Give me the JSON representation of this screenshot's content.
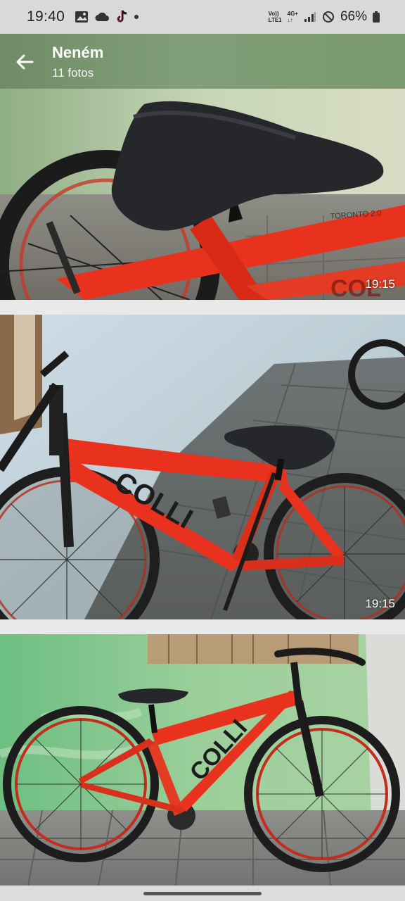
{
  "status_bar": {
    "time": "19:40",
    "left_icons": [
      "gallery-icon",
      "cloud-icon",
      "tiktok-icon",
      "dot-icon"
    ],
    "network_top": "Vo))",
    "network_bottom": "LTE1",
    "network2_top": "4G+",
    "battery_percent": "66%"
  },
  "app_bar": {
    "title": "Neném",
    "subtitle": "11 fotos"
  },
  "photos": [
    {
      "timestamp": "19:15"
    },
    {
      "timestamp": "19:15"
    },
    {
      "timestamp": ""
    }
  ],
  "colors": {
    "bike_red": "#e8321e",
    "app_bar_green": "#7a9a6f"
  }
}
